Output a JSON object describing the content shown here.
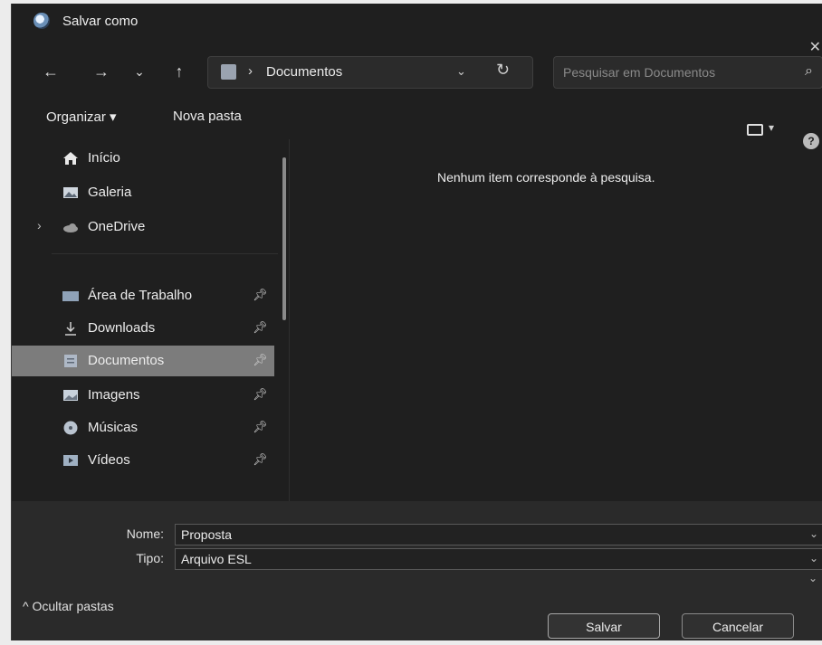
{
  "window": {
    "title": "Salvar como"
  },
  "addressbar": {
    "separator": "›",
    "crumb": "Documentos",
    "dropdown_glyph": "⌄",
    "refresh_glyph": "↻"
  },
  "search": {
    "placeholder": "Pesquisar em Documentos",
    "value": ""
  },
  "navigation": {
    "back_glyph": "←",
    "forward_glyph": "→",
    "recent_glyph": "⌄",
    "up_glyph": "↑"
  },
  "toolbar": {
    "organize_label": "Organizar ▾",
    "new_folder_label": "Nova pasta"
  },
  "sidebar": {
    "top_items": [
      {
        "label": "Início",
        "icon": "home-icon"
      },
      {
        "label": "Galeria",
        "icon": "gallery-icon"
      },
      {
        "label": "OneDrive",
        "icon": "cloud-icon"
      }
    ],
    "pinned_items": [
      {
        "label": "Área de Trabalho",
        "icon": "desktop-icon"
      },
      {
        "label": "Downloads",
        "icon": "download-icon"
      },
      {
        "label": "Documentos",
        "icon": "document-icon",
        "selected": true
      },
      {
        "label": "Imagens",
        "icon": "image-icon"
      },
      {
        "label": "Músicas",
        "icon": "music-icon"
      },
      {
        "label": "Vídeos",
        "icon": "video-icon"
      }
    ]
  },
  "content": {
    "empty_message": "Nenhum item corresponde à pesquisa."
  },
  "form": {
    "name_label": "Nome:",
    "name_value": "Proposta",
    "type_label": "Tipo:",
    "type_value": "Arquivo ESL"
  },
  "footer": {
    "hide_folders_label": "^  Ocultar pastas",
    "save_label": "Salvar",
    "cancel_label": "Cancelar"
  },
  "colors": {
    "window_bg": "#1f1f1f",
    "selected_item": "#7c7c7c",
    "text": "#e6e6e6"
  }
}
